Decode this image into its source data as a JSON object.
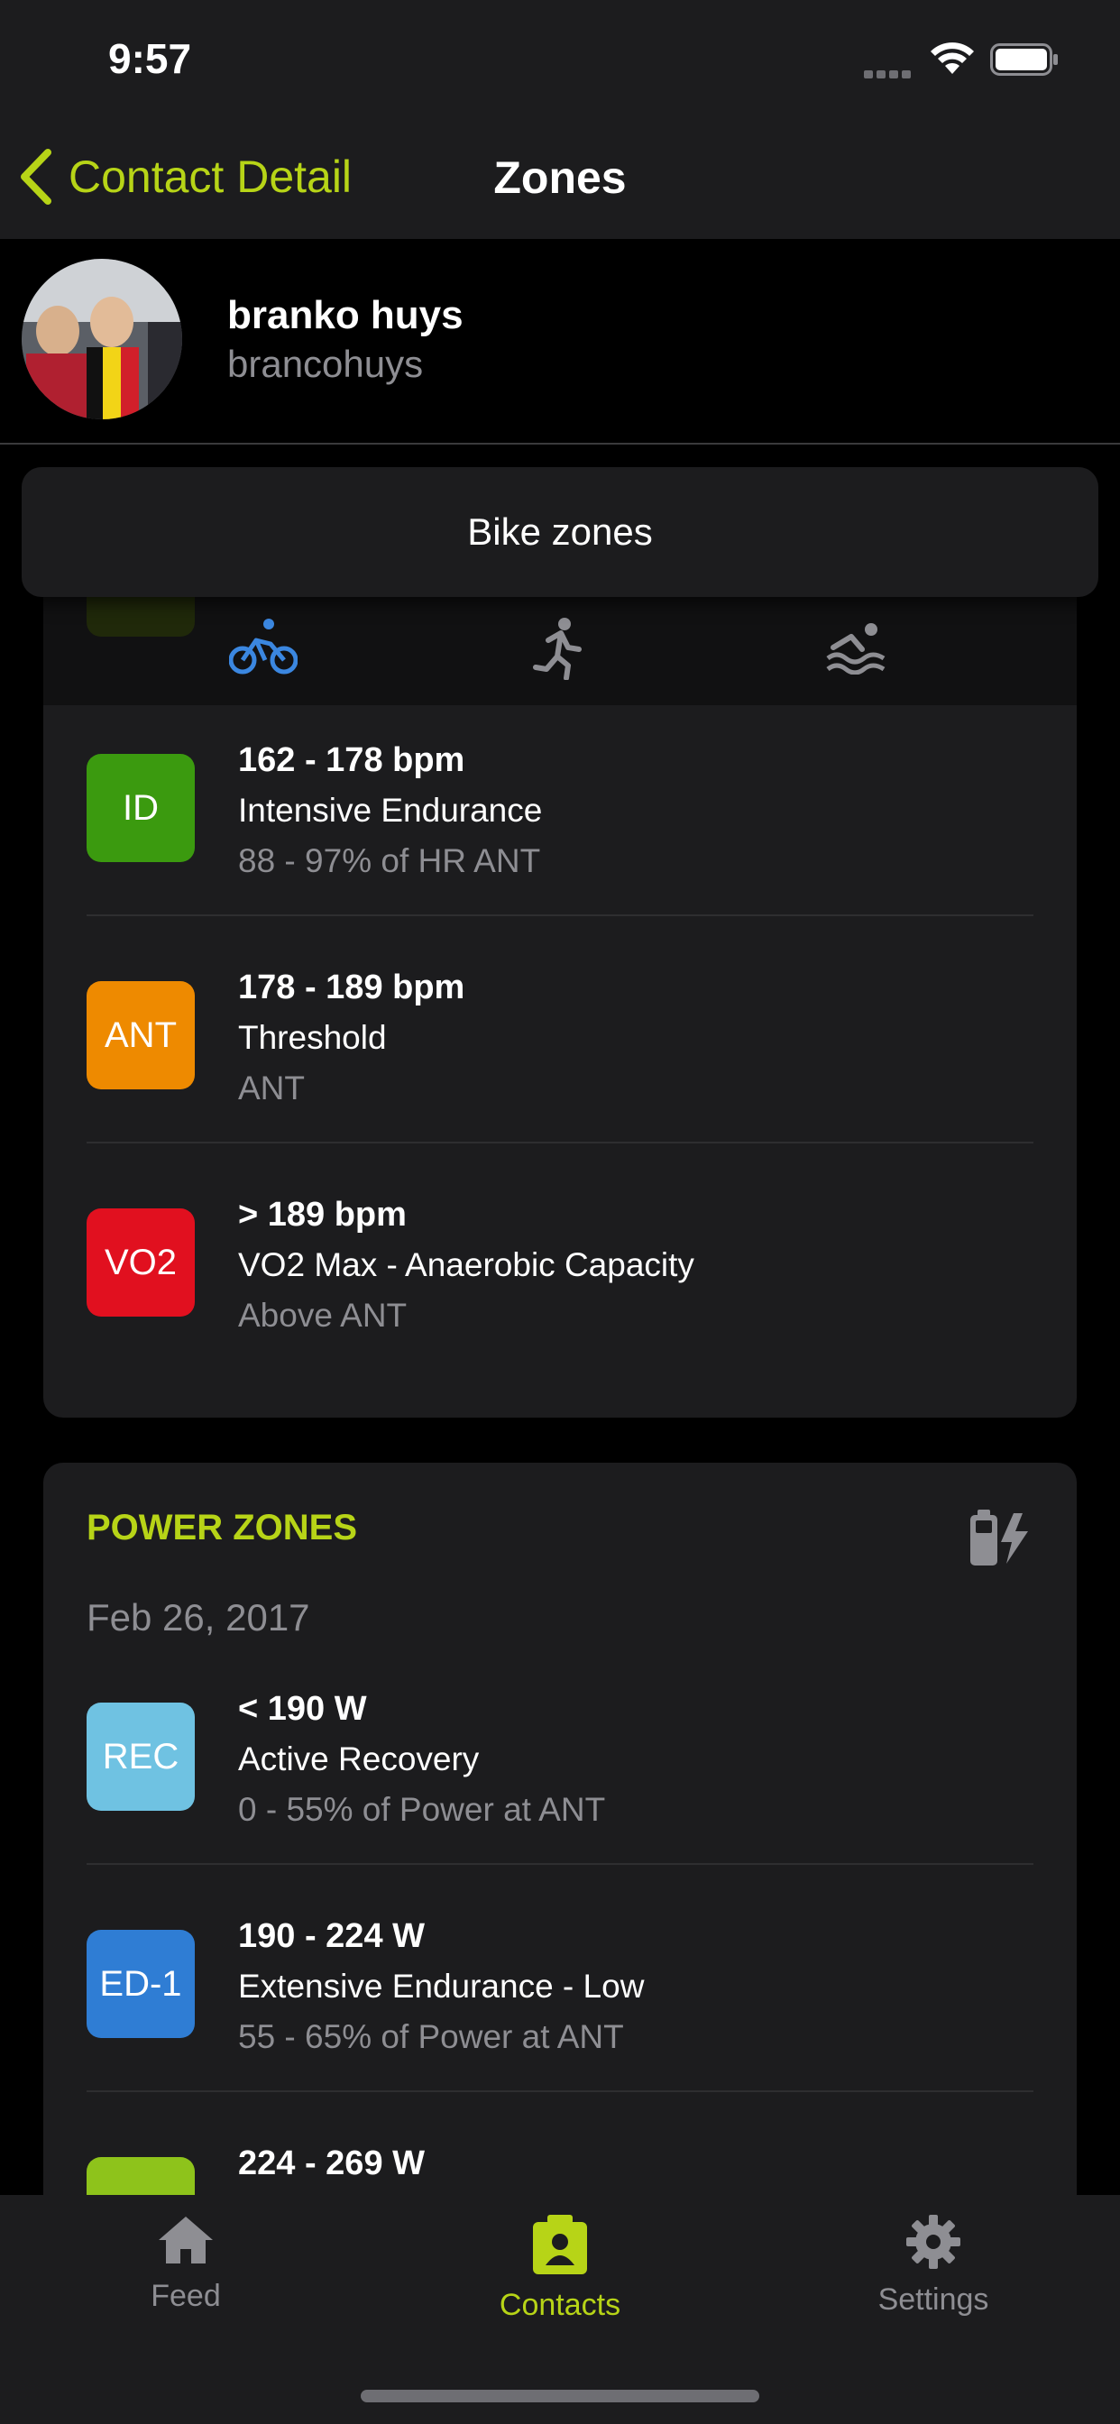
{
  "status_bar": {
    "time": "9:57"
  },
  "nav": {
    "back_label": "Contact Detail",
    "title": "Zones"
  },
  "profile": {
    "name": "branko huys",
    "username": "brancohuys"
  },
  "zone_selector": {
    "label": "Bike zones"
  },
  "colors": {
    "accent": "#b7d417",
    "ID": "#3b9a0f",
    "ANT": "#ee8a00",
    "VO2": "#e1101f",
    "REC": "#6fc2e2",
    "ED-1": "#2f7dd4",
    "ED-2": "#8ec31b"
  },
  "hr_zones": [
    {
      "code": "ID",
      "range": "162 - 178 bpm",
      "name": "Intensive Endurance",
      "desc": "88 - 97% of HR ANT"
    },
    {
      "code": "ANT",
      "range": "178 - 189 bpm",
      "name": "Threshold",
      "desc": "ANT"
    },
    {
      "code": "VO2",
      "range": "> 189 bpm",
      "name": "VO2 Max - Anaerobic Capacity",
      "desc": "Above ANT"
    }
  ],
  "power_zones": {
    "title": "POWER ZONES",
    "date": "Feb 26, 2017",
    "items": [
      {
        "code": "REC",
        "range": "< 190 W",
        "name": "Active Recovery",
        "desc": "0 - 55% of Power at ANT"
      },
      {
        "code": "ED-1",
        "range": "190 - 224 W",
        "name": "Extensive Endurance - Low",
        "desc": "55 - 65% of Power at ANT"
      },
      {
        "code": "",
        "range": "224 - 269 W",
        "name": "",
        "desc": ""
      }
    ]
  },
  "tabbar": {
    "feed": "Feed",
    "contacts": "Contacts",
    "settings": "Settings"
  }
}
